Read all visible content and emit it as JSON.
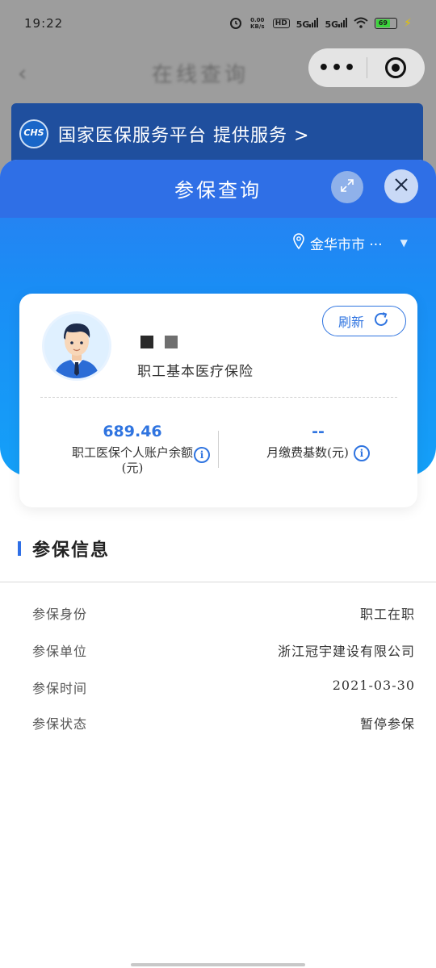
{
  "status_bar": {
    "time": "19:22",
    "net_speed": "0.00 KB/s",
    "hd_label": "HD",
    "signal_1": "5G",
    "signal_2": "5G",
    "battery": "69"
  },
  "background_page": {
    "title": "在线查询",
    "banner_logo": "CHS",
    "banner_text": "国家医保服务平台 提供服务 >"
  },
  "sheet": {
    "title": "参保查询",
    "region": "金华市市 ···"
  },
  "profile": {
    "insurance_type": "职工基本医疗保险",
    "refresh_label": "刷新",
    "account_balance_value": "689.46",
    "account_balance_label": "职工医保个人账户余额(元)",
    "monthly_base_value": "--",
    "monthly_base_label": "月缴费基数(元)"
  },
  "info_section": {
    "title": "参保信息",
    "rows": [
      {
        "label": "参保身份",
        "value": "职工在职"
      },
      {
        "label": "参保单位",
        "value": "浙江冠宇建设有限公司"
      },
      {
        "label": "参保时间",
        "value": "2021-03-30"
      },
      {
        "label": "参保状态",
        "value": "暂停参保"
      }
    ]
  },
  "colors": {
    "accent": "#2f74e0",
    "header_top": "#2f6fe6",
    "header_bottom": "#14a0f8"
  },
  "icons": [
    "alarm-icon",
    "wifi-icon",
    "back-icon",
    "more-icon",
    "miniprogram-close-icon",
    "expand-icon",
    "close-icon",
    "location-pin-icon",
    "caret-down-icon",
    "refresh-icon",
    "info-icon"
  ]
}
